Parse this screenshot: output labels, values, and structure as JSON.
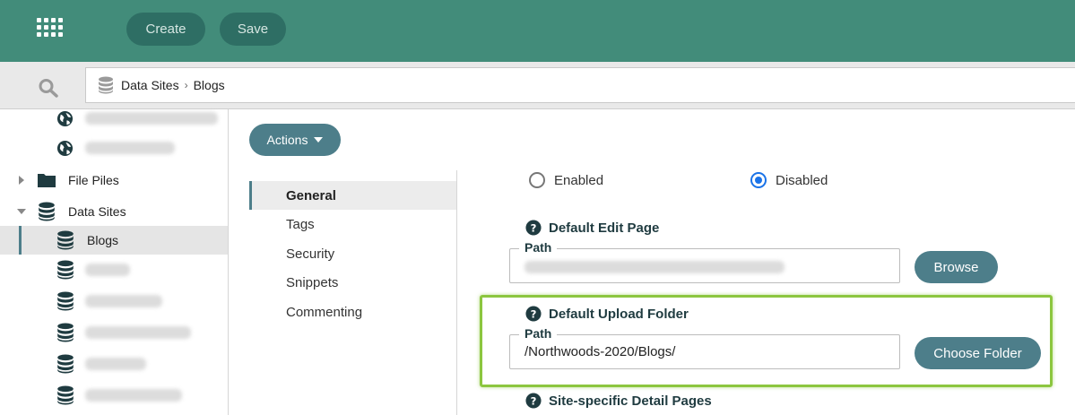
{
  "toolbar": {
    "apps_icon": "grid-icon",
    "create_label": "Create",
    "save_label": "Save"
  },
  "breadcrumb": {
    "icon": "database-icon",
    "root": "Data Sites",
    "separator": "›",
    "current": "Blogs"
  },
  "sidebar": {
    "items": [
      {
        "type": "globe",
        "label": ""
      },
      {
        "type": "globe",
        "label": ""
      },
      {
        "type": "folder",
        "label": "File Piles",
        "expanded": false
      },
      {
        "type": "database",
        "label": "Data Sites",
        "expanded": true
      },
      {
        "type": "database",
        "label": "Blogs",
        "selected": true
      },
      {
        "type": "database",
        "label": ""
      },
      {
        "type": "database",
        "label": ""
      },
      {
        "type": "database",
        "label": ""
      },
      {
        "type": "database",
        "label": ""
      },
      {
        "type": "database",
        "label": ""
      }
    ]
  },
  "actions": {
    "label": "Actions"
  },
  "subnav": {
    "items": [
      "General",
      "Tags",
      "Security",
      "Snippets",
      "Commenting"
    ],
    "active": "General"
  },
  "status": {
    "enabled_label": "Enabled",
    "disabled_label": "Disabled",
    "selected": "Disabled"
  },
  "default_edit_page": {
    "title": "Default Edit Page",
    "path_legend": "Path",
    "path_value": "",
    "button": "Browse"
  },
  "default_upload_folder": {
    "title": "Default Upload Folder",
    "path_legend": "Path",
    "path_value": "/Northwoods-2020/Blogs/",
    "button": "Choose Folder"
  },
  "site_specific": {
    "title": "Site-specific Detail Pages"
  },
  "colors": {
    "topbar": "#428c7a",
    "button": "#4d7e8a",
    "highlight": "#8cc63f",
    "radio_on": "#1a73e8"
  }
}
